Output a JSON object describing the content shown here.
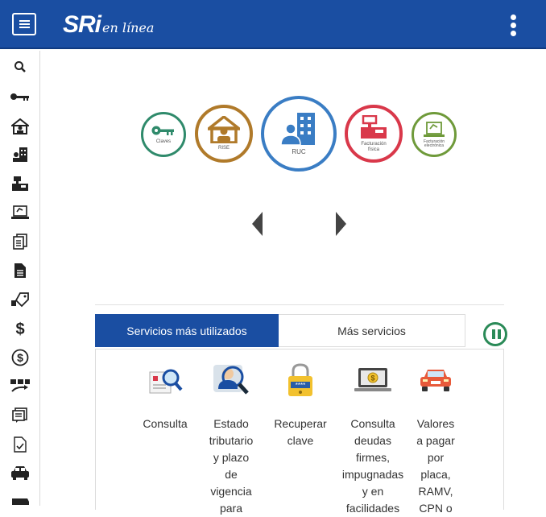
{
  "header": {
    "logo_main": "SRi",
    "logo_sub": "en línea",
    "menu_icon": "hamburger-icon",
    "more_icon": "vertical-dots-icon"
  },
  "sidebar": {
    "items": [
      {
        "icon": "search-icon"
      },
      {
        "icon": "key-icon"
      },
      {
        "icon": "house-person-icon"
      },
      {
        "icon": "buildings-icon"
      },
      {
        "icon": "cash-register-icon"
      },
      {
        "icon": "laptop-invoice-icon"
      },
      {
        "icon": "documents-icon"
      },
      {
        "icon": "document-icon"
      },
      {
        "icon": "hand-tag-icon"
      },
      {
        "icon": "dollar-icon"
      },
      {
        "icon": "dollar-circle-icon"
      },
      {
        "icon": "transfer-icon"
      },
      {
        "icon": "notes-icon"
      },
      {
        "icon": "checklist-icon"
      },
      {
        "icon": "car-icon"
      },
      {
        "icon": "truck-icon"
      }
    ]
  },
  "carousel": {
    "items": [
      {
        "label": "Claves",
        "color": "#2f8a6b"
      },
      {
        "label": "RISE",
        "color": "#b07a2a"
      },
      {
        "label": "RUC",
        "color": "#3a7dc4"
      },
      {
        "label": "Facturación\nfísica",
        "color": "#d9384a"
      },
      {
        "label": "Facturación\nelectrónica",
        "color": "#6f9a3a"
      }
    ]
  },
  "tabs": {
    "active": "Servicios más utilizados",
    "inactive": "Más servicios"
  },
  "services": [
    {
      "label": "Consulta",
      "icon": "document-magnifier-icon"
    },
    {
      "label": "Estado\ntributario\ny plazo\nde\nvigencia\npara",
      "icon": "person-magnifier-icon"
    },
    {
      "label": "Recuperar\nclave",
      "icon": "padlock-icon"
    },
    {
      "label": "Consulta\ndeudas\nfirmes,\nimpugnadas\ny en\nfacilidades",
      "icon": "laptop-coin-icon"
    },
    {
      "label": "Valores\na pagar\npor\nplaca,\nRAMV,\nCPN o",
      "icon": "car-icon"
    }
  ],
  "colors": {
    "brand_blue": "#1a4ea2",
    "accent_green": "#2a8a57"
  }
}
